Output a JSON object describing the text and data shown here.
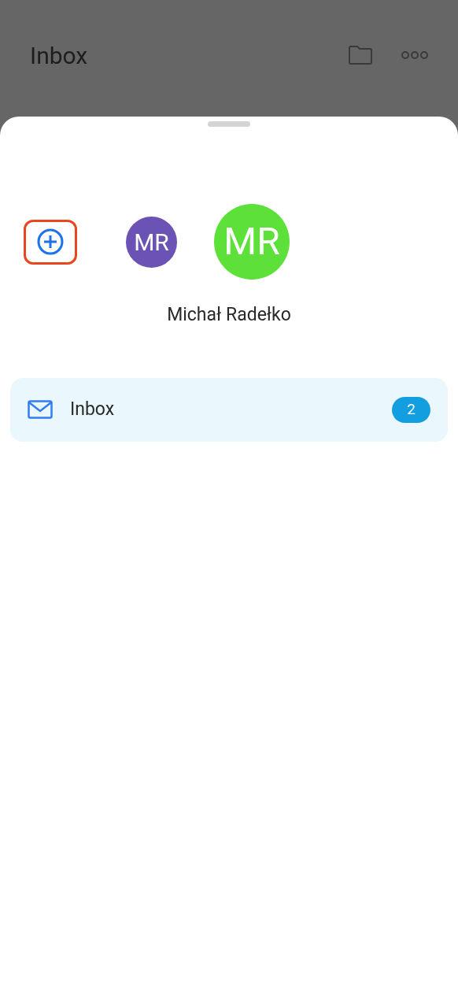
{
  "header": {
    "title": "Inbox"
  },
  "add_account": {
    "highlighted": true
  },
  "accounts": [
    {
      "initials": "MR",
      "color": "#6b52b5",
      "selected": false
    },
    {
      "initials": "MR",
      "color": "#5ee03b",
      "selected": true
    }
  ],
  "account_name": "Michał Radełko",
  "folders": [
    {
      "name": "Inbox",
      "count": "2",
      "selected": true
    }
  ]
}
